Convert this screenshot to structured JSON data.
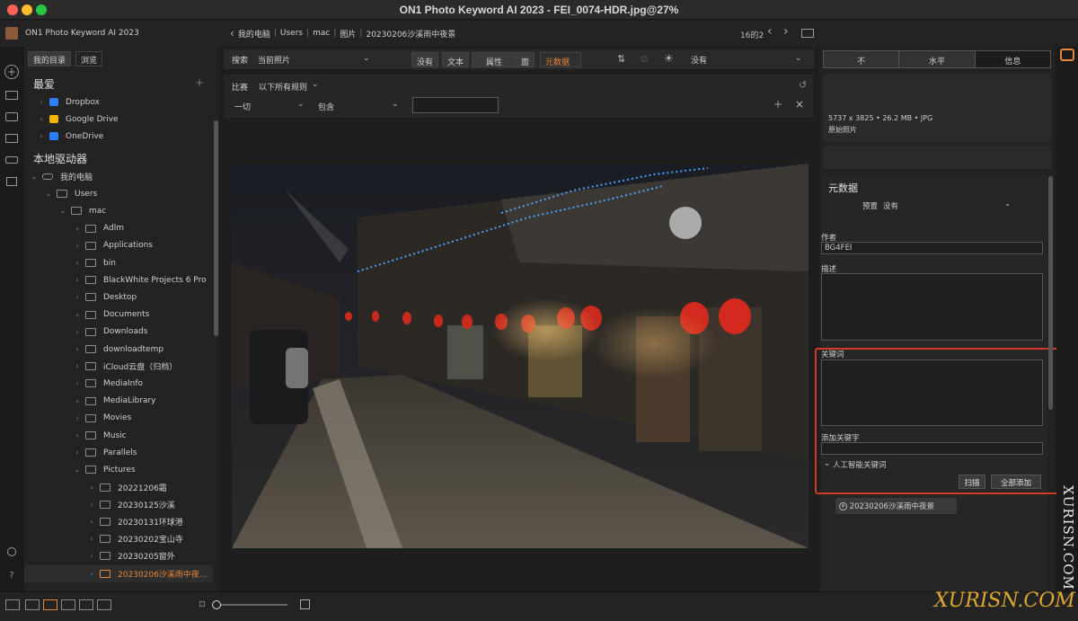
{
  "window": {
    "title": "ON1 Photo Keyword AI 2023 - FEI_0074-HDR.jpg@27%"
  },
  "header": {
    "app_name": "ON1 Photo Keyword AI 2023",
    "breadcrumb": [
      "我的电脑",
      "Users",
      "mac",
      "图片",
      "20230206沙溪雨中夜景"
    ],
    "counter": "16的2"
  },
  "browser": {
    "tabs": [
      "我的目录",
      "浏览"
    ],
    "favorites_title": "最爱",
    "favorites": [
      {
        "label": "Dropbox",
        "icon": "dropbox-icon",
        "color": "#2d7ff9"
      },
      {
        "label": "Google Drive",
        "icon": "google-drive-icon",
        "color": "#f4b400"
      },
      {
        "label": "OneDrive",
        "icon": "onedrive-icon",
        "color": "#2d7ff9"
      }
    ],
    "local_title": "本地驱动器",
    "tree": [
      {
        "label": "我的电脑",
        "level": 0,
        "expanded": true,
        "kind": "drive"
      },
      {
        "label": "Users",
        "level": 1,
        "expanded": true
      },
      {
        "label": "mac",
        "level": 2,
        "expanded": true
      },
      {
        "label": "Adlm",
        "level": 3
      },
      {
        "label": "Applications",
        "level": 3
      },
      {
        "label": "bin",
        "level": 3
      },
      {
        "label": "BlackWhite Projects 6 Pro",
        "level": 3
      },
      {
        "label": "Desktop",
        "level": 3
      },
      {
        "label": "Documents",
        "level": 3
      },
      {
        "label": "Downloads",
        "level": 3
      },
      {
        "label": "downloadtemp",
        "level": 3
      },
      {
        "label": "iCloud云盘（归档）",
        "level": 3
      },
      {
        "label": "MediaInfo",
        "level": 3
      },
      {
        "label": "MediaLibrary",
        "level": 3
      },
      {
        "label": "Movies",
        "level": 3
      },
      {
        "label": "Music",
        "level": 3
      },
      {
        "label": "Parallels",
        "level": 3
      },
      {
        "label": "Pictures",
        "level": 3,
        "expanded": true
      },
      {
        "label": "20221206霜",
        "level": 4
      },
      {
        "label": "20230125沙溪",
        "level": 4
      },
      {
        "label": "20230131环球港",
        "level": 4
      },
      {
        "label": "20230202宝山寺",
        "level": 4
      },
      {
        "label": "20230205窗外",
        "level": 4
      },
      {
        "label": "20230206沙溪雨中夜...",
        "level": 4,
        "selected": true
      }
    ]
  },
  "filter": {
    "search_label": "搜索",
    "search_scope": "当前照片",
    "segments": [
      "没有",
      "文本",
      "属性",
      "面",
      "元数据"
    ],
    "active_segment": "元数据",
    "sort_value": "没有",
    "match_label": "比赛",
    "match_rule": "以下所有规则",
    "field_select": "一切",
    "op_select": "包含",
    "value_input": ""
  },
  "info": {
    "tabs": [
      "不",
      "水平",
      "信息"
    ],
    "active_tab": "信息",
    "file_meta": "5737 x 3825 • 26.2 MB • JPG",
    "file_kind": "原始照片"
  },
  "metadata": {
    "title": "元数据",
    "preset_label": "预置",
    "preset_value": "没有",
    "author_label": "作者",
    "author_value": "BG4FEI",
    "description_label": "描述",
    "keywords_label": "关键词",
    "add_keyword_label": "添加关键字",
    "ai_keywords_label": "人工智能关键词",
    "scan_button": "扫描",
    "add_all_button": "全部添加",
    "tag_chip": "20230206沙溪雨中夜景"
  },
  "watermark": {
    "vertical": "XURISN.COM",
    "bottom": "XURISN.COM"
  },
  "colors": {
    "accent": "#e8873a",
    "highlight": "#d13b2a",
    "bg": "#1e1e1e"
  }
}
